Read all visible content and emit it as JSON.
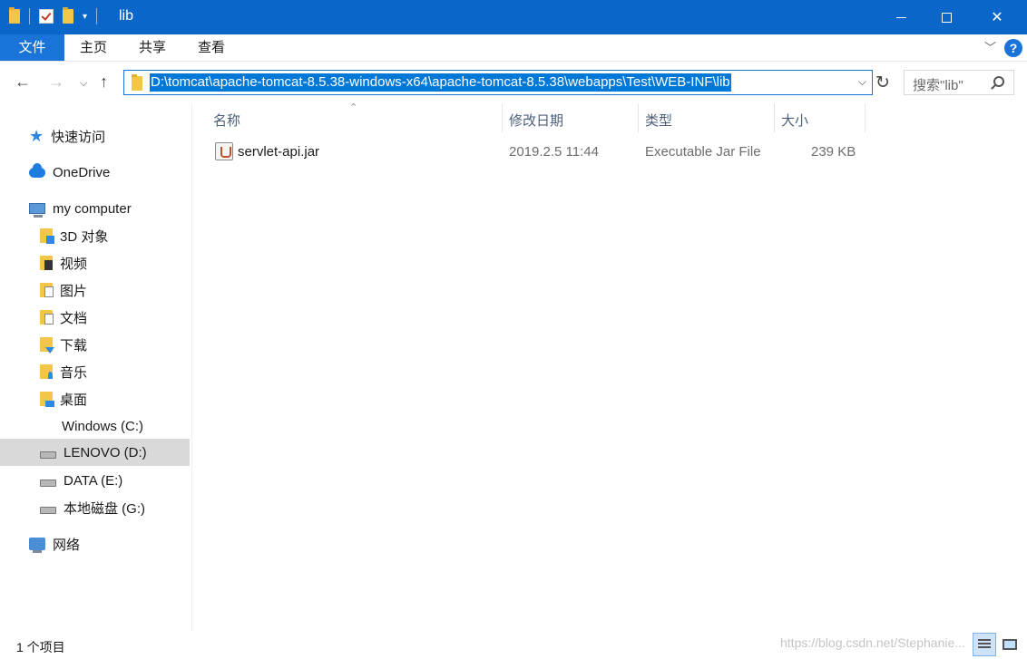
{
  "window": {
    "title": "lib",
    "controls": {
      "minimize": "",
      "maximize": "",
      "close": "✕"
    }
  },
  "ribbon": {
    "tabs": [
      {
        "label": "文件",
        "active": true
      },
      {
        "label": "主页"
      },
      {
        "label": "共享"
      },
      {
        "label": "查看"
      }
    ],
    "help": "?"
  },
  "address": {
    "path": "D:\\tomcat\\apache-tomcat-8.5.38-windows-x64\\apache-tomcat-8.5.38\\webapps\\Test\\WEB-INF\\lib",
    "search_placeholder": "搜索\"lib\""
  },
  "sidebar": {
    "items": [
      {
        "label": "快速访问",
        "icon": "star-icon"
      },
      {
        "label": "OneDrive",
        "icon": "cloud-icon"
      },
      {
        "label": "my computer",
        "icon": "computer-icon"
      },
      {
        "label": "3D 对象",
        "icon": "3d-objects-folder-icon"
      },
      {
        "label": "视频",
        "icon": "videos-folder-icon"
      },
      {
        "label": "图片",
        "icon": "pictures-folder-icon"
      },
      {
        "label": "文档",
        "icon": "documents-folder-icon"
      },
      {
        "label": "下载",
        "icon": "downloads-folder-icon"
      },
      {
        "label": "音乐",
        "icon": "music-folder-icon"
      },
      {
        "label": "桌面",
        "icon": "desktop-folder-icon"
      },
      {
        "label": "Windows (C:)",
        "icon": "windows-drive-icon"
      },
      {
        "label": "LENOVO (D:)",
        "icon": "drive-icon",
        "selected": true
      },
      {
        "label": "DATA (E:)",
        "icon": "drive-icon"
      },
      {
        "label": "本地磁盘 (G:)",
        "icon": "drive-icon"
      },
      {
        "label": "网络",
        "icon": "network-icon"
      }
    ]
  },
  "file_list": {
    "columns": [
      "名称",
      "修改日期",
      "类型",
      "大小"
    ],
    "rows": [
      {
        "name": "servlet-api.jar",
        "date": "2019.2.5 11:44",
        "type": "Executable Jar File",
        "size": "239 KB",
        "icon": "jar-file-icon"
      }
    ]
  },
  "status": {
    "item_count": "1 个项目",
    "watermark": "https://blog.csdn.net/Stephanie..."
  }
}
